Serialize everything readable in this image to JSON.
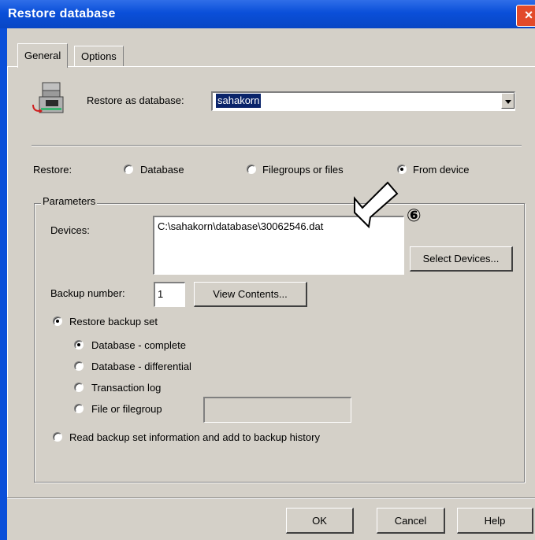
{
  "window": {
    "title": "Restore database",
    "close_icon": "×"
  },
  "tabs": [
    {
      "label": "General",
      "active": true
    },
    {
      "label": "Options",
      "active": false
    }
  ],
  "restore_as": {
    "label": "Restore as database:",
    "value": "sahakorn"
  },
  "restore": {
    "label": "Restore:",
    "options": [
      {
        "label": "Database",
        "selected": false
      },
      {
        "label": "Filegroups or files",
        "selected": false
      },
      {
        "label": "From device",
        "selected": true
      }
    ]
  },
  "parameters": {
    "legend": "Parameters",
    "devices_label": "Devices:",
    "devices": [
      "C:\\sahakorn\\database\\30062546.dat"
    ],
    "select_devices_button": "Select Devices...",
    "backup_number_label": "Backup number:",
    "backup_number_value": "1",
    "view_contents_button": "View Contents...",
    "restore_backup_set_label": "Restore backup set",
    "backup_types": [
      {
        "label": "Database - complete",
        "selected": true
      },
      {
        "label": "Database - differential",
        "selected": false
      },
      {
        "label": "Transaction log",
        "selected": false
      },
      {
        "label": "File or filegroup",
        "selected": false
      }
    ],
    "read_backup_info_label": "Read backup set information and add to backup history"
  },
  "annotation": {
    "marker": "⑥"
  },
  "buttons": {
    "ok": "OK",
    "cancel": "Cancel",
    "help": "Help"
  },
  "colors": {
    "titlebar": "#0a4fd9",
    "dialog_bg": "#d4d0c8",
    "selection": "#0a246a",
    "close_button": "#e24a2a"
  }
}
